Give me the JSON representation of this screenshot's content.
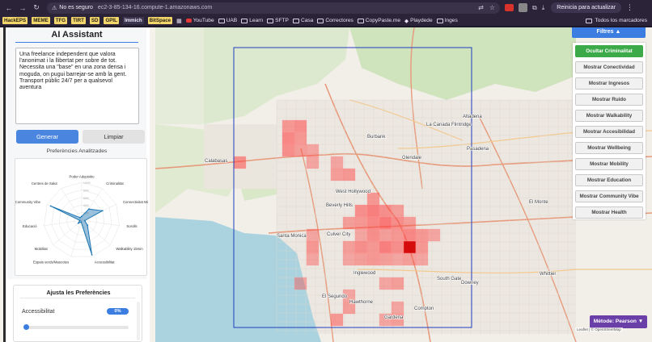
{
  "browser": {
    "security_label": "No es seguro",
    "url": "ec2-3-85-134-16.compute-1.amazonaws.com",
    "update_button": "Reinicia para actualizar"
  },
  "bookmarks": {
    "tags": [
      "HackEPS",
      "MEME",
      "TFG",
      "TIRT",
      "SD",
      "GPIL",
      "Immich",
      "BitSpace"
    ],
    "items": [
      "YouTube",
      "UAB",
      "Learn",
      "SFTP",
      "Casa",
      "Correctores",
      "CopyPaste.me",
      "Playdede",
      "Inges"
    ],
    "all_bookmarks": "Todos los marcadores"
  },
  "sidebar": {
    "title": "AI Assistant",
    "prompt_text": "Una freelance independent que valora l'anonimat i la llibertat per sobre de tot. Necessita una \"base\" en una zona densa i moguda, on pugui barrejar-se amb la gent. Transport públic 24/7 per a qualsevol aventura",
    "generate_button": "Generar",
    "clear_button": "Limpiar",
    "preferences_title": "Preferències Analitzades",
    "adjust_title": "Ajusta les Preferències",
    "adjust_label": "Accessibilitat",
    "adjust_value": "0%",
    "adjust_fraction": 0
  },
  "chart_data": {
    "type": "radar",
    "axes": [
      "Poder Adquisitiu",
      "Criminalitat",
      "Connectivitat WiFi",
      "Sorolls",
      "Walkability 15min",
      "Accessibilitat",
      "Espais verds/Mascotes",
      "Mobilitat",
      "Educació",
      "Community Vibe",
      "Centres de Salut"
    ],
    "tick_labels": [
      "100%",
      "80%",
      "60%",
      "40%",
      "20%"
    ],
    "values": [
      0.1,
      0.35,
      0.6,
      0.08,
      0.2,
      0.95,
      0.05,
      0.12,
      0.05,
      0.9,
      0.08
    ],
    "color": "#1f77b4"
  },
  "map": {
    "filters_title": "Filtres ▲",
    "filters": [
      {
        "label": "Ocultar Criminalitat",
        "active": true
      },
      {
        "label": "Mostrar Conectividad",
        "active": false
      },
      {
        "label": "Mostrar Ingresos",
        "active": false
      },
      {
        "label": "Mostrar Ruido",
        "active": false
      },
      {
        "label": "Mostrar Walkability",
        "active": false
      },
      {
        "label": "Mostrar Accesibilidad",
        "active": false
      },
      {
        "label": "Mostrar Wellbeing",
        "active": false
      },
      {
        "label": "Mostrar Mobility",
        "active": false
      },
      {
        "label": "Mostrar Education",
        "active": false
      },
      {
        "label": "Mostrar Community Vibe",
        "active": false
      },
      {
        "label": "Mostrar Health",
        "active": false
      }
    ],
    "method_button": "Mètode: Pearson ▼",
    "attribution": "Leaflet | © OpenStreetMap",
    "places": [
      "Burbank",
      "Glendale",
      "Pasadena",
      "West Hollywood",
      "Beverly Hills",
      "Culver City",
      "Santa Monica",
      "Inglewood",
      "South Gate",
      "Downey",
      "Compton",
      "Gardena",
      "El Monte",
      "Calabasas",
      "Altadena",
      "La Canada Flintridge",
      "El Segundo",
      "Hawthorne",
      "Whittier"
    ],
    "accent_colors": {
      "heat": "#ff3b3b",
      "bbox": "#1f3fbf"
    }
  }
}
